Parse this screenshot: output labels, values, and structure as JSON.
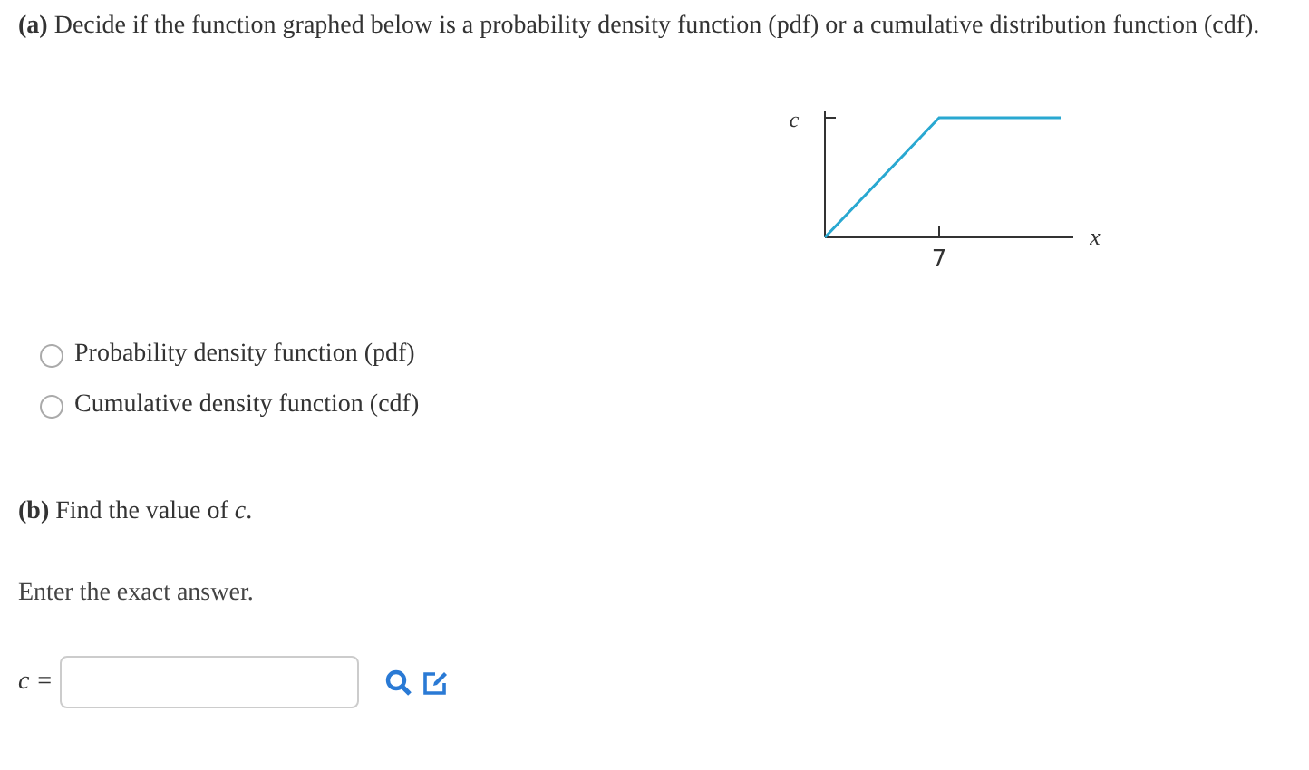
{
  "part_a": {
    "prompt": "**(a)** Decide if the function graphed below is a probability density function (pdf) or a cumulative distribution function (cdf).",
    "graph": {
      "y_label": "c",
      "x_tick": "7",
      "x_label": "x"
    },
    "options": [
      {
        "label": "Probability density function (pdf)",
        "selected": false
      },
      {
        "label": "Cumulative density function (cdf)",
        "selected": false
      }
    ]
  },
  "part_b": {
    "prompt": "**(b)** Find the value of *c*.",
    "instruction": "Enter the exact answer.",
    "answer_label": "c ="
  }
}
